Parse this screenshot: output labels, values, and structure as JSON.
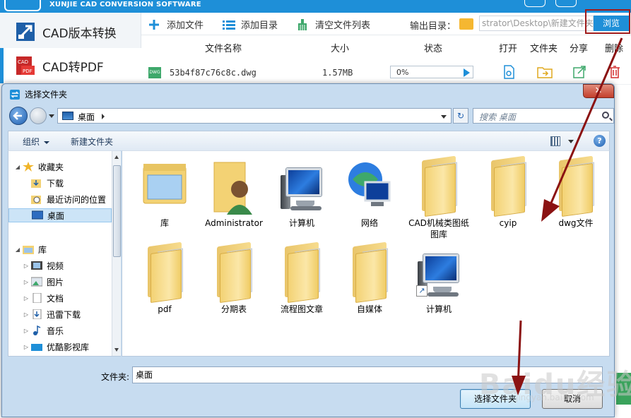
{
  "app": {
    "brand": "XUNJIE CAD CONVERSION SOFTWARE",
    "sidebar": [
      {
        "label": "CAD版本转换"
      },
      {
        "label": "CAD转PDF"
      }
    ],
    "toolbar": {
      "add_file": "添加文件",
      "add_folder": "添加目录",
      "clear_list": "清空文件列表",
      "output_label": "输出目录：",
      "output_path": "strator\\Desktop\\新建文件夹",
      "browse": "浏览"
    },
    "columns": {
      "name": "文件名称",
      "size": "大小",
      "status": "状态",
      "open": "打开",
      "folder": "文件夹",
      "share": "分享",
      "delete": "删除"
    },
    "row": {
      "icon_text": "DWG",
      "name": "53b4f87c76c8c.dwg",
      "size": "1.57MB",
      "progress": "0%"
    }
  },
  "dialog": {
    "title": "选择文件夹",
    "address": "桌面",
    "search_placeholder": "搜索 桌面",
    "organize": "组织",
    "new_folder": "新建文件夹",
    "nav_tree": [
      {
        "label": "收藏夹",
        "icon": "star-icon",
        "level": 0,
        "expander": "◢"
      },
      {
        "label": "下载",
        "icon": "download-folder-icon",
        "level": 1,
        "expander": ""
      },
      {
        "label": "最近访问的位置",
        "icon": "recent-places-icon",
        "level": 1,
        "expander": ""
      },
      {
        "label": "桌面",
        "icon": "desktop-icon",
        "level": 1,
        "expander": "",
        "selected": true
      },
      {
        "label": "库",
        "icon": "library-icon",
        "level": 0,
        "expander": "◢"
      },
      {
        "label": "视频",
        "icon": "video-library-icon",
        "level": 1,
        "expander": "▷"
      },
      {
        "label": "图片",
        "icon": "pictures-library-icon",
        "level": 1,
        "expander": "▷"
      },
      {
        "label": "文档",
        "icon": "documents-library-icon",
        "level": 1,
        "expander": "▷"
      },
      {
        "label": "迅雷下载",
        "icon": "download-library-icon",
        "level": 1,
        "expander": "▷"
      },
      {
        "label": "音乐",
        "icon": "music-library-icon",
        "level": 1,
        "expander": "▷"
      },
      {
        "label": "优酷影视库",
        "icon": "youku-library-icon",
        "level": 1,
        "expander": "▷"
      }
    ],
    "items": [
      {
        "label": "库",
        "icon": "library-icon"
      },
      {
        "label": "Administrator",
        "icon": "user-folder-icon"
      },
      {
        "label": "计算机",
        "icon": "computer-icon"
      },
      {
        "label": "网络",
        "icon": "network-icon"
      },
      {
        "label": "CAD机械类图纸图库",
        "icon": "folder-icon"
      },
      {
        "label": "cyip",
        "icon": "folder-icon"
      },
      {
        "label": "dwg文件",
        "icon": "folder-icon"
      },
      {
        "label": "pdf",
        "icon": "folder-icon"
      },
      {
        "label": "分期表",
        "icon": "folder-icon"
      },
      {
        "label": "流程图文章",
        "icon": "folder-icon"
      },
      {
        "label": "自媒体",
        "icon": "folder-icon"
      },
      {
        "label": "计算机",
        "icon": "computer-shortcut-icon"
      }
    ],
    "folder_label": "文件夹:",
    "folder_value": "桌面",
    "select_button": "选择文件夹",
    "cancel_button": "取消"
  },
  "watermark": {
    "main": "Baidu经验",
    "sub": "jingyan.baidu.com"
  },
  "colors": {
    "accent": "#1e8fd8",
    "annotation": "#8b1212",
    "selection": "#cce4f7"
  }
}
